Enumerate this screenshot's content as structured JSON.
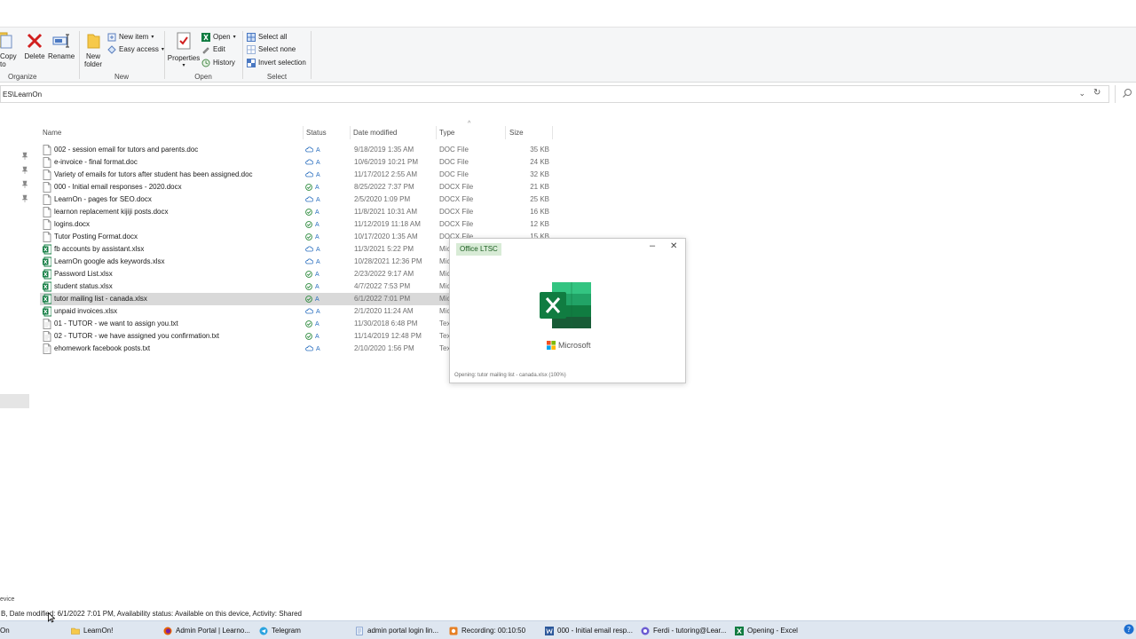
{
  "ribbon": {
    "organize": {
      "label": "Organize",
      "copy_to": "Copy\nto",
      "copy_line1": "Copy",
      "copy_line2": "to",
      "delete": "Delete",
      "rename": "Rename"
    },
    "new": {
      "label": "New",
      "new_folder_line1": "New",
      "new_folder_line2": "folder",
      "new_item": "New item",
      "easy_access": "Easy access"
    },
    "open": {
      "label": "Open",
      "properties": "Properties",
      "open": "Open",
      "edit": "Edit",
      "history": "History"
    },
    "select": {
      "label": "Select",
      "select_all": "Select all",
      "select_none": "Select none",
      "invert_selection": "Invert selection"
    }
  },
  "address": {
    "path": "ES\\LearnOn"
  },
  "columns": {
    "name": "Name",
    "status": "Status",
    "date_modified": "Date modified",
    "type": "Type",
    "size": "Size"
  },
  "files": [
    {
      "name": "002 - session email for tutors and parents.doc",
      "date": "9/18/2019 1:35 AM",
      "type": "DOC File",
      "size": "35 KB",
      "kind": "doc",
      "status": "cloud"
    },
    {
      "name": "e-invoice - final format.doc",
      "date": "10/6/2019 10:21 PM",
      "type": "DOC File",
      "size": "24 KB",
      "kind": "doc",
      "status": "cloud"
    },
    {
      "name": "Variety of emails for tutors after student has been assigned.doc",
      "date": "11/17/2012 2:55 AM",
      "type": "DOC File",
      "size": "32 KB",
      "kind": "doc",
      "status": "cloud"
    },
    {
      "name": "000 - Initial email responses - 2020.docx",
      "date": "8/25/2022 7:37 PM",
      "type": "DOCX File",
      "size": "21 KB",
      "kind": "doc",
      "status": "synced"
    },
    {
      "name": "LearnOn - pages for SEO.docx",
      "date": "2/5/2020 1:09 PM",
      "type": "DOCX File",
      "size": "25 KB",
      "kind": "doc",
      "status": "cloud"
    },
    {
      "name": "learnon replacement kijiji posts.docx",
      "date": "11/8/2021 10:31 AM",
      "type": "DOCX File",
      "size": "16 KB",
      "kind": "doc",
      "status": "synced"
    },
    {
      "name": "logins.docx",
      "date": "11/12/2019 11:18 AM",
      "type": "DOCX File",
      "size": "12 KB",
      "kind": "doc",
      "status": "synced"
    },
    {
      "name": "Tutor Posting Format.docx",
      "date": "10/17/2020 1:35 AM",
      "type": "DOCX File",
      "size": "15 KB",
      "kind": "doc",
      "status": "synced"
    },
    {
      "name": "fb accounts by assistant.xlsx",
      "date": "11/3/2021 5:22 PM",
      "type": "Mic",
      "size": "",
      "kind": "xls",
      "status": "cloud"
    },
    {
      "name": "LearnOn google ads keywords.xlsx",
      "date": "10/28/2021 12:36 PM",
      "type": "Mic",
      "size": "",
      "kind": "xls",
      "status": "cloud"
    },
    {
      "name": "Password List.xlsx",
      "date": "2/23/2022 9:17 AM",
      "type": "Mic",
      "size": "",
      "kind": "xls",
      "status": "synced"
    },
    {
      "name": "student status.xlsx",
      "date": "4/7/2022 7:53 PM",
      "type": "Mic",
      "size": "",
      "kind": "xls",
      "status": "synced"
    },
    {
      "name": "tutor mailing list - canada.xlsx",
      "date": "6/1/2022 7:01 PM",
      "type": "Mic",
      "size": "",
      "kind": "xls",
      "status": "synced",
      "selected": true
    },
    {
      "name": "unpaid invoices.xlsx",
      "date": "2/1/2020 11:24 AM",
      "type": "Mic",
      "size": "",
      "kind": "xls",
      "status": "cloud"
    },
    {
      "name": "01 - TUTOR - we want to assign you.txt",
      "date": "11/30/2018 6:48 PM",
      "type": "Tex",
      "size": "",
      "kind": "txt",
      "status": "synced"
    },
    {
      "name": "02 - TUTOR - we have assigned you confirmation.txt",
      "date": "11/14/2019 12:48 PM",
      "type": "Tex",
      "size": "",
      "kind": "txt",
      "status": "synced"
    },
    {
      "name": "ehomework facebook posts.txt",
      "date": "2/10/2020 1:56 PM",
      "type": "Tex",
      "size": "",
      "kind": "txt",
      "status": "cloud"
    }
  ],
  "status_glyph": "A",
  "splash": {
    "badge": "Office LTSC",
    "brand": "Microsoft",
    "progress_text": "Opening: tutor mailing list - canada.xlsx (100%)"
  },
  "left_edge_text": "evice",
  "statusbar": {
    "text": "B, Date modified: 6/1/2022 7:01 PM, Availability status: Available on this device, Activity: Shared"
  },
  "taskbar": [
    {
      "label": "On",
      "icon": "folder-icon"
    },
    {
      "label": "LearnOn!",
      "icon": "folder-icon"
    },
    {
      "label": "Admin Portal | Learno...",
      "icon": "firefox-icon"
    },
    {
      "label": "Telegram",
      "icon": "telegram-icon"
    },
    {
      "label": "admin portal login lin...",
      "icon": "notepad-icon"
    },
    {
      "label": "Recording:  00:10:50",
      "icon": "record-icon"
    },
    {
      "label": "000 - Initial email resp...",
      "icon": "word-icon"
    },
    {
      "label": "Ferdi - tutoring@Lear...",
      "icon": "browser-icon"
    },
    {
      "label": "Opening - Excel",
      "icon": "excel-icon"
    }
  ],
  "colors": {
    "excel_green": "#107c41",
    "word_blue": "#2b579a",
    "selected_row": "#d9d9d9",
    "badge_bg": "#d8ebd6",
    "taskbar_bg": "#dee6f0"
  }
}
